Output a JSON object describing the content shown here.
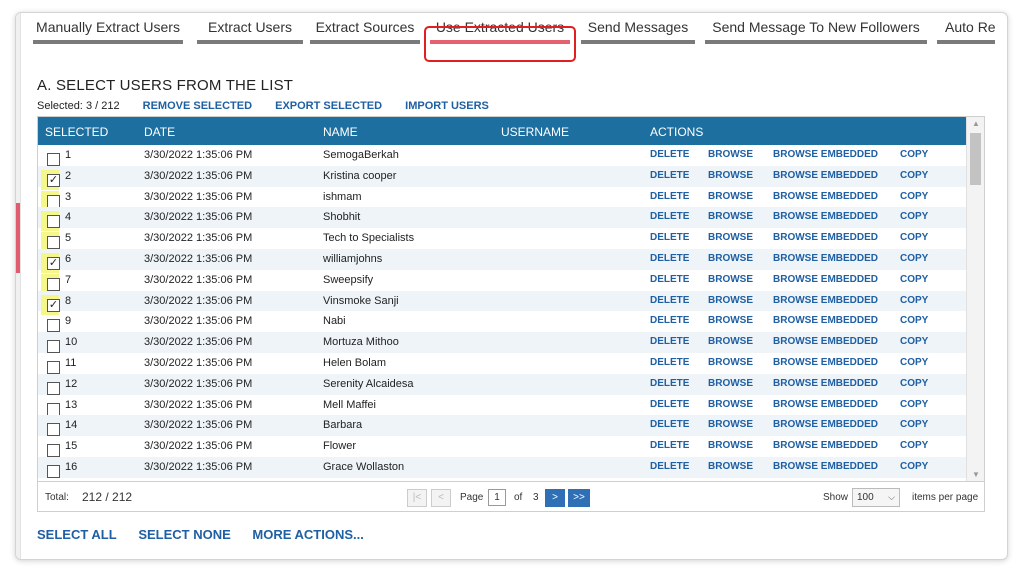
{
  "tabs": [
    {
      "label": "Manually Extract Users"
    },
    {
      "label": "Extract Users"
    },
    {
      "label": "Extract Sources"
    },
    {
      "label": "Use Extracted Users"
    },
    {
      "label": "Send Messages"
    },
    {
      "label": "Send Message To New Followers"
    },
    {
      "label": "Auto Repl"
    }
  ],
  "section_title": "A. SELECT USERS FROM THE LIST",
  "selection": {
    "label": "Selected:",
    "value": "3 / 212",
    "remove": "REMOVE SELECTED",
    "export": "EXPORT SELECTED",
    "import": "IMPORT USERS"
  },
  "grid": {
    "headers": {
      "selected": "SELECTED",
      "date": "DATE",
      "name": "NAME",
      "username": "USERNAME",
      "actions": "ACTIONS"
    },
    "action_labels": {
      "delete": "DELETE",
      "browse": "BROWSE",
      "embedded": "BROWSE EMBEDDED",
      "copy": "COPY"
    },
    "rows": [
      {
        "n": "1",
        "date": "3/30/2022 1:35:06 PM",
        "name": "SemogaBerkah",
        "checked": false,
        "hl": false
      },
      {
        "n": "2",
        "date": "3/30/2022 1:35:06 PM",
        "name": "Kristina cooper",
        "checked": true,
        "hl": true
      },
      {
        "n": "3",
        "date": "3/30/2022 1:35:06 PM",
        "name": "ishmam",
        "checked": false,
        "hl": true
      },
      {
        "n": "4",
        "date": "3/30/2022 1:35:06 PM",
        "name": "Shobhit",
        "checked": false,
        "hl": true
      },
      {
        "n": "5",
        "date": "3/30/2022 1:35:06 PM",
        "name": "Tech to Specialists",
        "checked": false,
        "hl": true
      },
      {
        "n": "6",
        "date": "3/30/2022 1:35:06 PM",
        "name": "williamjohns",
        "checked": true,
        "hl": true
      },
      {
        "n": "7",
        "date": "3/30/2022 1:35:06 PM",
        "name": "Sweepsify",
        "checked": false,
        "hl": true
      },
      {
        "n": "8",
        "date": "3/30/2022 1:35:06 PM",
        "name": "Vinsmoke Sanji",
        "checked": true,
        "hl": true
      },
      {
        "n": "9",
        "date": "3/30/2022 1:35:06 PM",
        "name": "Nabi",
        "checked": false,
        "hl": false
      },
      {
        "n": "10",
        "date": "3/30/2022 1:35:06 PM",
        "name": "Mortuza Mithoo",
        "checked": false,
        "hl": false
      },
      {
        "n": "11",
        "date": "3/30/2022 1:35:06 PM",
        "name": "Helen Bolam",
        "checked": false,
        "hl": false
      },
      {
        "n": "12",
        "date": "3/30/2022 1:35:06 PM",
        "name": "Serenity Alcaidesa",
        "checked": false,
        "hl": false
      },
      {
        "n": "13",
        "date": "3/30/2022 1:35:06 PM",
        "name": "Mell Maffei",
        "checked": false,
        "hl": false
      },
      {
        "n": "14",
        "date": "3/30/2022 1:35:06 PM",
        "name": "Barbara",
        "checked": false,
        "hl": false
      },
      {
        "n": "15",
        "date": "3/30/2022 1:35:06 PM",
        "name": "Flower",
        "checked": false,
        "hl": false
      },
      {
        "n": "16",
        "date": "3/30/2022 1:35:06 PM",
        "name": "Grace Wollaston",
        "checked": false,
        "hl": false
      }
    ]
  },
  "footer": {
    "total_label": "Total:",
    "total_value": "212  /  212",
    "first": "|<",
    "prev": "<",
    "page_label": "Page",
    "page_value": "1",
    "of_label": "of",
    "page_count": "3",
    "next": ">",
    "last": ">>",
    "show_label": "Show",
    "per_page": "100",
    "per_page_label": "items per page"
  },
  "bottom_actions": {
    "select_all": "SELECT ALL",
    "select_none": "SELECT NONE",
    "more": "MORE ACTIONS..."
  },
  "colors": {
    "header": "#1d6fa0",
    "link": "#1f5fa3",
    "active_tab": "#e4626f",
    "highlight": "#f6f78a"
  }
}
